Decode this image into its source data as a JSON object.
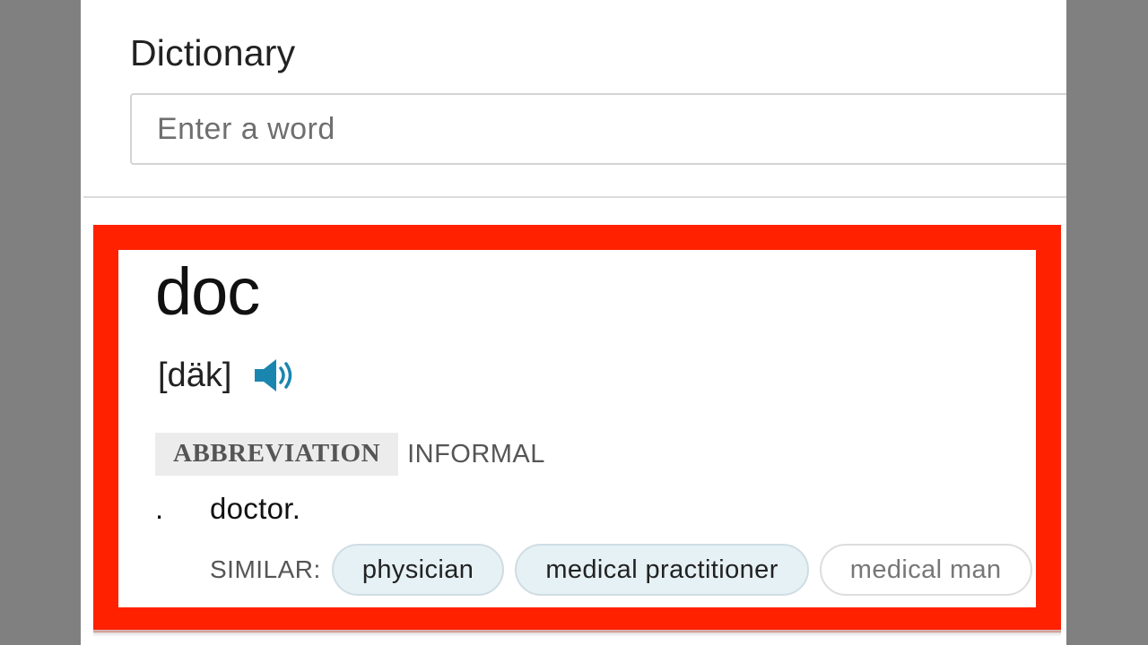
{
  "app": {
    "title": "Dictionary"
  },
  "search": {
    "placeholder": "Enter a word",
    "value": ""
  },
  "entry": {
    "word": "doc",
    "pronunciation": "[däk]",
    "audio_icon": "speaker-icon",
    "part_of_speech": "ABBREVIATION",
    "register": "INFORMAL",
    "senses": [
      {
        "number": ".",
        "definition": "doctor.",
        "similar_label": "SIMILAR:",
        "similar": [
          {
            "label": "physician",
            "style": "filled"
          },
          {
            "label": "medical practitioner",
            "style": "filled"
          },
          {
            "label": "medical man",
            "style": "outlined"
          }
        ]
      }
    ]
  },
  "colors": {
    "highlight_border": "#ff2100",
    "audio_icon": "#1a86b0",
    "chip_filled_bg": "#e6f1f5",
    "page_background": "#808080"
  }
}
